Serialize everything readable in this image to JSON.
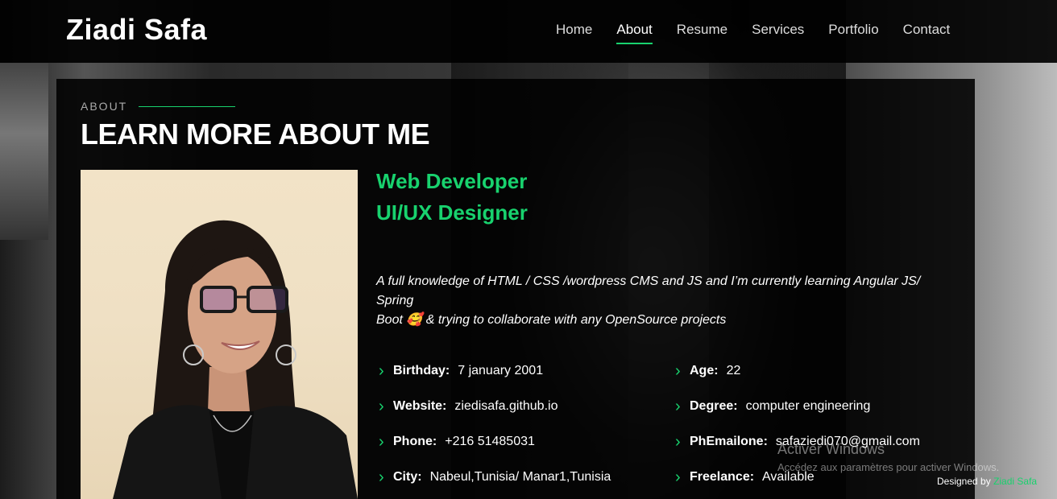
{
  "brand": {
    "name": "Ziadi Safa"
  },
  "nav": {
    "items": [
      {
        "label": "Home",
        "active": false
      },
      {
        "label": "About",
        "active": true
      },
      {
        "label": "Resume",
        "active": false
      },
      {
        "label": "Services",
        "active": false
      },
      {
        "label": "Portfolio",
        "active": false
      },
      {
        "label": "Contact",
        "active": false
      }
    ]
  },
  "about": {
    "kicker": "ABOUT",
    "heading": "LEARN MORE ABOUT ME",
    "role_1": "Web Developer",
    "role_2": "UI/UX Designer",
    "bio_line_1": "A full knowledge of HTML / CSS /wordpress CMS and JS and I’m currently learning Angular JS/ Spring",
    "bio_line_2": "Boot  🥰 & trying to collaborate with any OpenSource projects",
    "info_left": [
      {
        "key": "Birthday:",
        "value": "7 january 2001"
      },
      {
        "key": "Website:",
        "value": "ziedisafa.github.io"
      },
      {
        "key": "Phone:",
        "value": "+216 51485031"
      },
      {
        "key": "City:",
        "value": "Nabeul,Tunisia/ Manar1,Tunisia"
      }
    ],
    "info_right": [
      {
        "key": "Age:",
        "value": "22"
      },
      {
        "key": "Degree:",
        "value": "computer engineering"
      },
      {
        "key": "PhEmailone:",
        "value": "safaziedi070@gmail.com"
      },
      {
        "key": "Freelance:",
        "value": "Available"
      }
    ]
  },
  "windows_watermark": {
    "title": "Activer Windows",
    "subtitle": "Accédez aux paramètres pour activer Windows."
  },
  "footer": {
    "designed_by": "Designed by",
    "designer": "Ziadi Safa"
  },
  "colors": {
    "accent": "#18d26e",
    "panel": "#000000"
  }
}
